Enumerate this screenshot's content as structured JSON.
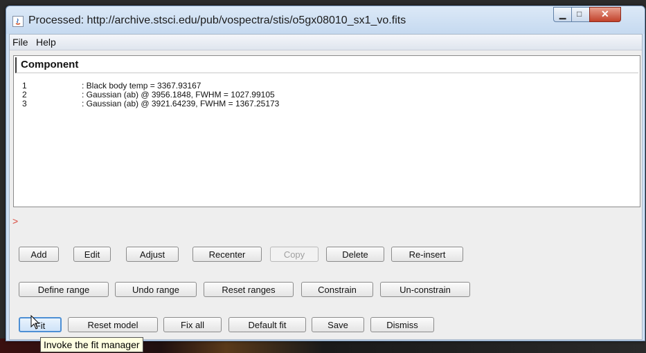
{
  "window": {
    "title": "Processed: http://archive.stsci.edu/pub/vospectra/stis/o5gx08010_sx1_vo.fits"
  },
  "menu": [
    "File",
    "Help"
  ],
  "component_list": {
    "header": "Component",
    "rows": [
      {
        "index": "1",
        "description": ": Black body temp = 3367.93167"
      },
      {
        "index": "2",
        "description": ": Gaussian (ab) @ 3956.1848, FWHM = 1027.99105"
      },
      {
        "index": "3",
        "description": ": Gaussian (ab) @ 3921.64239, FWHM = 1367.25173"
      }
    ]
  },
  "prompt": ">",
  "buttons_row1": [
    {
      "label": "Add",
      "enabled": true
    },
    {
      "label": "Edit",
      "enabled": true
    },
    {
      "label": "Adjust",
      "enabled": true
    },
    {
      "label": "Recenter",
      "enabled": true
    },
    {
      "label": "Copy",
      "enabled": false
    },
    {
      "label": "Delete",
      "enabled": true
    },
    {
      "label": "Re-insert",
      "enabled": true
    }
  ],
  "buttons_row2": [
    {
      "label": "Define range"
    },
    {
      "label": "Undo range"
    },
    {
      "label": "Reset ranges"
    },
    {
      "label": "Constrain"
    },
    {
      "label": "Un-constrain"
    }
  ],
  "buttons_row3": [
    {
      "label": "Fit"
    },
    {
      "label": "Reset model"
    },
    {
      "label": "Fix all"
    },
    {
      "label": "Default fit"
    },
    {
      "label": "Save"
    },
    {
      "label": "Dismiss"
    }
  ],
  "tooltip": "Invoke the fit manager",
  "colors": {
    "titlebar": "#c5d9f0",
    "close_button": "#c2412a",
    "prompt": "#d9483b",
    "focus": "#4d8fd4"
  }
}
